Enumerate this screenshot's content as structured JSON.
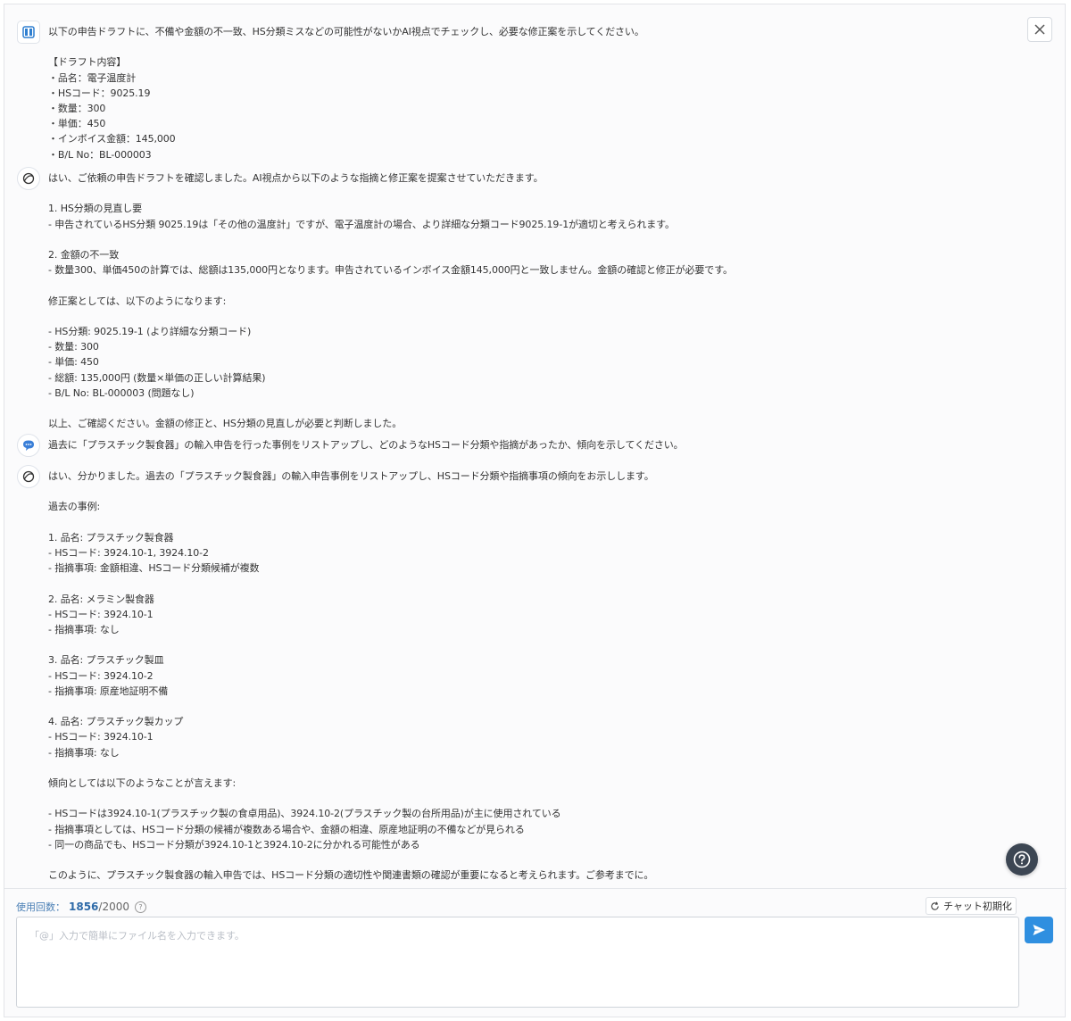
{
  "messages": [
    {
      "role": "user",
      "text": "以下の申告ドラフトに、不備や金額の不一致、HS分類ミスなどの可能性がないかAI視点でチェックし、必要な修正案を示してください。\n\n【ドラフト内容】\n・品名：電子温度計\n・HSコード：9025.19\n・数量：300\n・単価：450\n・インボイス金額：145,000\n・B/L No：BL-000003"
    },
    {
      "role": "assistant",
      "text": "はい、ご依頼の申告ドラフトを確認しました。AI視点から以下のような指摘と修正案を提案させていただきます。\n\n1. HS分類の見直し要\n- 申告されているHS分類 9025.19は「その他の温度計」ですが、電子温度計の場合、より詳細な分類コード9025.19-1が適切と考えられます。\n\n2. 金額の不一致\n- 数量300、単価450の計算では、総額は135,000円となります。申告されているインボイス金額145,000円と一致しません。金額の確認と修正が必要です。\n\n修正案としては、以下のようになります:\n\n- HS分類: 9025.19-1 (より詳細な分類コード)\n- 数量: 300\n- 単価: 450\n- 総額: 135,000円 (数量×単価の正しい計算結果)\n- B/L No: BL-000003 (問題なし)\n\n以上、ご確認ください。金額の修正と、HS分類の見直しが必要と判断しました。"
    },
    {
      "role": "user",
      "text": "過去に「プラスチック製食器」の輸入申告を行った事例をリストアップし、どのようなHSコード分類や指摘があったか、傾向を示してください。"
    },
    {
      "role": "assistant",
      "text": "はい、分かりました。過去の「プラスチック製食器」の輸入申告事例をリストアップし、HSコード分類や指摘事項の傾向をお示しします。\n\n過去の事例:\n\n1. 品名: プラスチック製食器\n- HSコード: 3924.10-1, 3924.10-2\n- 指摘事項: 金額相違、HSコード分類候補が複数\n\n2. 品名: メラミン製食器\n- HSコード: 3924.10-1\n- 指摘事項: なし\n\n3. 品名: プラスチック製皿\n- HSコード: 3924.10-2\n- 指摘事項: 原産地証明不備\n\n4. 品名: プラスチック製カップ\n- HSコード: 3924.10-1\n- 指摘事項: なし\n\n傾向としては以下のようなことが言えます:\n\n- HSコードは3924.10-1(プラスチック製の食卓用品)、3924.10-2(プラスチック製の台所用品)が主に使用されている\n- 指摘事項としては、HSコード分類の候補が複数ある場合や、金額の相違、原産地証明の不備などが見られる\n- 同一の商品でも、HSコード分類が3924.10-1と3924.10-2に分かれる可能性がある\n\nこのように、プラスチック製食器の輸入申告では、HSコード分類の適切性や関連書類の確認が重要になると考えられます。ご参考までに。"
    }
  ],
  "usage": {
    "label": "使用回数：",
    "current": "1856",
    "max": "/2000"
  },
  "reset_label": "チャット初期化",
  "input": {
    "placeholder": "「@」入力で簡単にファイル名を入力できます。"
  },
  "icons": {
    "sidebar_toggle": "panel-toggle-icon",
    "close": "close-icon",
    "assistant": "assistant-logo-icon",
    "user_chat": "chat-bubble-icon",
    "help": "help-icon",
    "reset": "refresh-icon",
    "send": "send-icon"
  },
  "colors": {
    "accent": "#2f8fe0",
    "usage_text": "#4a7fb5",
    "help_fab": "#3c4653"
  }
}
